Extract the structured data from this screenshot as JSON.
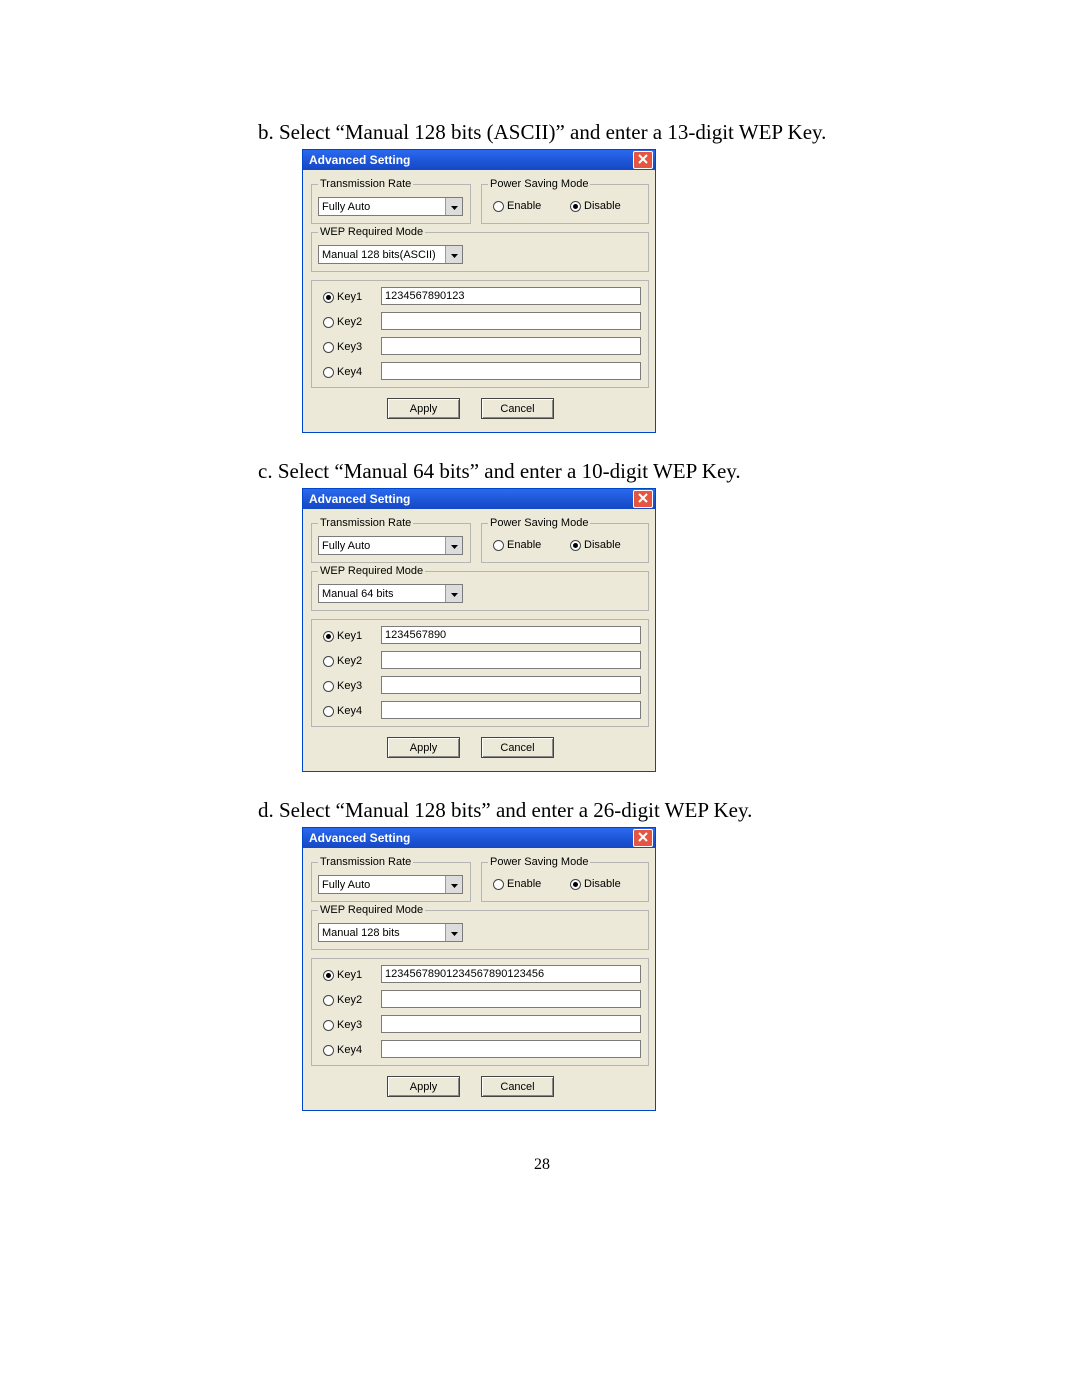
{
  "page_number": "28",
  "instructions": {
    "b": "b. Select “Manual 128 bits (ASCII)” and enter a 13-digit WEP Key.",
    "c": "c. Select “Manual 64 bits” and enter a 10-digit WEP Key.",
    "d": "d. Select “Manual 128 bits” and enter a 26-digit WEP Key."
  },
  "labels": {
    "window_title": "Advanced Setting",
    "transmission_rate": "Transmission Rate",
    "power_saving_mode": "Power Saving Mode",
    "wep_required_mode": "WEP Required Mode",
    "enable": "Enable",
    "disable": "Disable",
    "key1": "Key1",
    "key2": "Key2",
    "key3": "Key3",
    "key4": "Key4",
    "apply": "Apply",
    "cancel": "Cancel",
    "transmission_rate_value": "Fully Auto"
  },
  "dialogs": {
    "b": {
      "wep_mode": "Manual 128 bits(ASCII)",
      "key1": "1234567890123"
    },
    "c": {
      "wep_mode": "Manual 64 bits",
      "key1": "1234567890"
    },
    "d": {
      "wep_mode": "Manual 128 bits",
      "key1": "12345678901234567890123456"
    }
  }
}
